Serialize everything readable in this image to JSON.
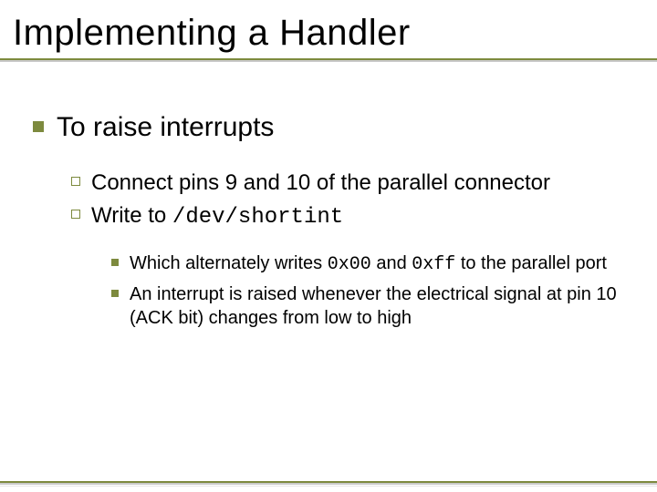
{
  "title": "Implementing a Handler",
  "bullets": {
    "lvl1": {
      "a": "To raise interrupts"
    },
    "lvl2": {
      "a": "Connect pins 9 and 10 of the parallel connector",
      "b_pre": "Write to ",
      "b_code": "/dev/shortint"
    },
    "lvl3": {
      "a_pre": "Which alternately writes ",
      "a_code1": "0x00",
      "a_mid": " and ",
      "a_code2": "0xff",
      "a_post": " to the parallel port",
      "b": "An interrupt is raised whenever the electrical signal at pin 10 (ACK bit) changes from low to high"
    }
  },
  "colors": {
    "accent": "#7d8a3e"
  }
}
